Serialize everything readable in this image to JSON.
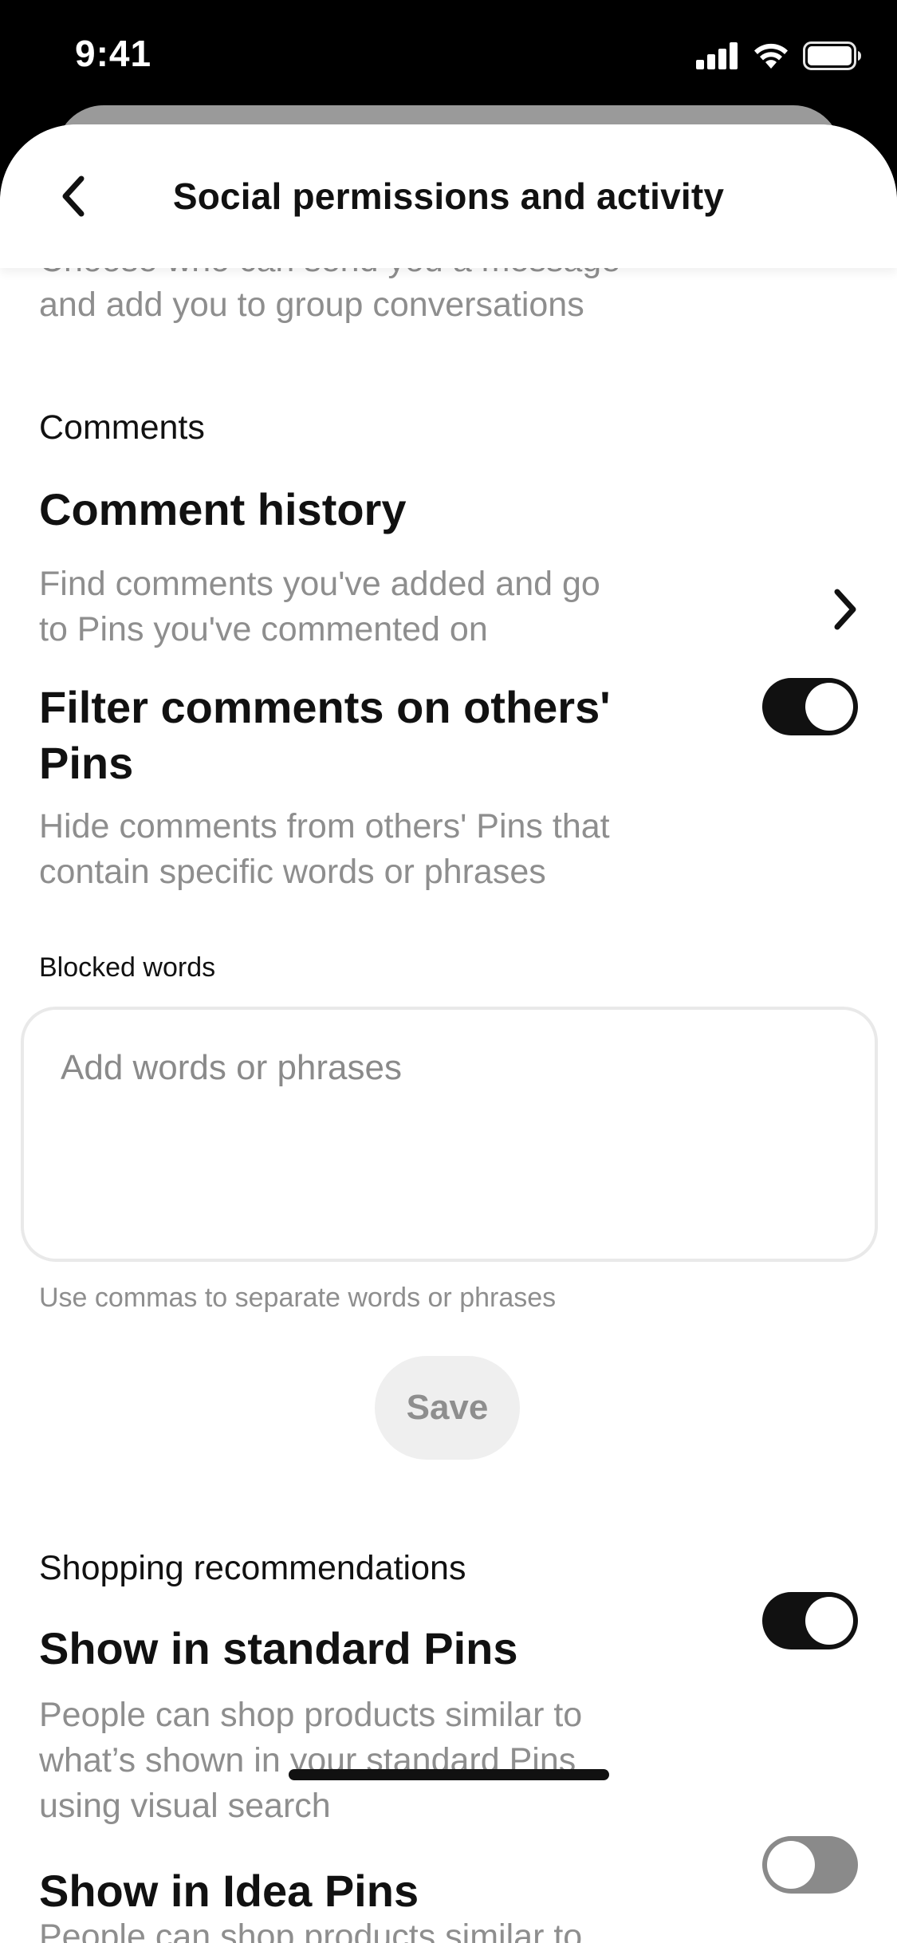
{
  "status_bar": {
    "time": "9:41"
  },
  "header": {
    "title": "Social permissions and activity"
  },
  "messages": {
    "partial_line": "Choose who can send you a message",
    "description_line2": "and add you to group conversations"
  },
  "comments": {
    "section_label": "Comments",
    "history_title": "Comment history",
    "history_desc_1": "Find comments you've added and go",
    "history_desc_2": "to Pins you've commented on",
    "filter_title_1": "Filter comments on others'",
    "filter_title_2": "Pins",
    "filter_desc_1": "Hide comments from others' Pins that",
    "filter_desc_2": "contain specific words or phrases",
    "filter_enabled": true,
    "blocked_label": "Blocked words",
    "blocked_placeholder": "Add words or phrases",
    "blocked_value": "",
    "helper_text": "Use commas to separate words or phrases",
    "save_label": "Save"
  },
  "shopping": {
    "section_label": "Shopping recommendations",
    "standard_title": "Show in standard Pins",
    "standard_desc_1": "People can shop products similar to",
    "standard_desc_2": "what’s shown in your standard Pins",
    "standard_desc_3": "using visual search",
    "standard_enabled": true,
    "idea_title": "Show in Idea Pins",
    "idea_desc_1": "People can shop products similar to",
    "idea_enabled": false
  }
}
